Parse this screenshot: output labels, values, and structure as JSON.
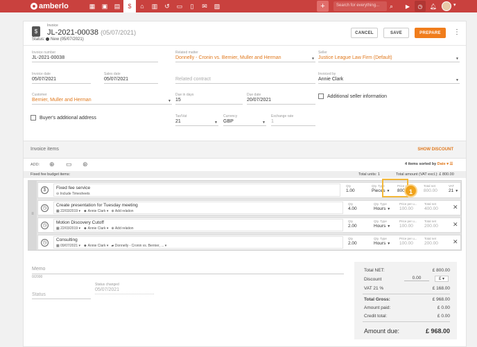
{
  "app": {
    "brand": "amberlo"
  },
  "topbar": {
    "nav_icons": [
      "dashboard-icon",
      "contacts-icon",
      "matters-icon",
      "invoices-icon",
      "bank-icon",
      "calendar-icon",
      "history-icon",
      "folder-icon",
      "documents-icon",
      "mail-icon",
      "reports-icon"
    ],
    "search_placeholder": "Search for everything...",
    "plus": "+"
  },
  "header": {
    "small_label": "Invoice",
    "number": "JL-2021-00038",
    "date": "(05/07/2021)",
    "status_label": "Status:",
    "status_value": "New (05/07/2021)",
    "cancel": "CANCEL",
    "save": "SAVE",
    "prepare": "PREPARE"
  },
  "fields": {
    "invoice_number": {
      "label": "Invoice number",
      "value": "JL-2021-00038"
    },
    "related_matter": {
      "label": "Related matter",
      "value": "Donnelly - Cronin vs. Bernier, Muller and Herman"
    },
    "seller": {
      "label": "Seller",
      "value": "Justice League Law Firm (Default)"
    },
    "invoice_date": {
      "label": "Invoice date",
      "value": "05/07/2021"
    },
    "sales_date": {
      "label": "Sales date",
      "value": "05/07/2021"
    },
    "related_contract": {
      "placeholder": "Related contract"
    },
    "invoiced_by": {
      "label": "Invoiced by",
      "value": "Annie Clark"
    },
    "customer": {
      "label": "Customer",
      "value": "Bernier, Muller and Herman"
    },
    "due_in_days": {
      "label": "Due in days",
      "value": "15"
    },
    "due_date": {
      "label": "Due date",
      "value": "20/07/2021"
    },
    "additional_seller": "Additional seller information",
    "buyer_additional": "Buyer's additional address",
    "tax_vat": {
      "label": "Tax/Vat",
      "value": "21"
    },
    "currency": {
      "label": "Currency",
      "value": "GBP"
    },
    "exchange_rate": {
      "label": "Exchange rate",
      "value": "1"
    }
  },
  "items": {
    "section_title": "Invoice items",
    "show_discount": "SHOW DISCOUNT",
    "add_label": "ADD:",
    "sorted_prefix": "4 items sorted by",
    "sorted_by": "Date",
    "budget_label": "Fixed fee budget items:",
    "total_units": "Total units: 1",
    "total_amount": "Total amount (VAT excl.): £ 800.00",
    "col_labels": {
      "qty": "Qty",
      "qty_type": "Qty. Type",
      "price": "Price per u...",
      "total_net": "Total net",
      "vat": "VAT"
    },
    "fixed_fee": {
      "description": "Fixed fee service",
      "sub": "Include Timesheets",
      "qty": "1.00",
      "qty_type": "Pieces",
      "price": "800.00",
      "total_net": "800.00",
      "vat": "21"
    },
    "lines": [
      {
        "description": "Create presentation for Tuesday meeting",
        "date": "22/03/2019",
        "user": "Annie Clark",
        "extra": "Add relation",
        "qty": "4.00",
        "qty_type": "Hours",
        "price": "100.00",
        "total_net": "400.00"
      },
      {
        "description": "Motion Discovery Cutoff",
        "date": "22/03/2019",
        "user": "Annie Clark",
        "extra": "Add relation",
        "qty": "2.00",
        "qty_type": "Hours",
        "price": "100.00",
        "total_net": "200.00"
      },
      {
        "description": "Consulting",
        "date": "09/07/2021",
        "user": "Annie Clark",
        "extra": "Donnelly - Cronin vs. Bernier, ...",
        "qty": "2.00",
        "qty_type": "Hours",
        "price": "100.00",
        "total_net": "200.00"
      }
    ],
    "callout_number": "1"
  },
  "memo": {
    "memo_label": "Memo",
    "memo_count": "0/2000",
    "status_label": "Status",
    "status_changed_label": "Status changed",
    "status_changed_value": "05/07/2021"
  },
  "totals": {
    "total_net_label": "Total NET:",
    "total_net": "£ 800.00",
    "discount_label": "Discount",
    "discount_value": "0.00",
    "discount_currency": "£",
    "vat_label": "VAT 21 %",
    "vat": "£ 168.00",
    "gross_label": "Total Gross:",
    "gross": "£ 968.00",
    "paid_label": "Amount paid:",
    "paid": "£ 0.00",
    "credit_label": "Credit total:",
    "credit": "£ 0.00",
    "due_label": "Amount due:",
    "due": "£ 968.00"
  }
}
